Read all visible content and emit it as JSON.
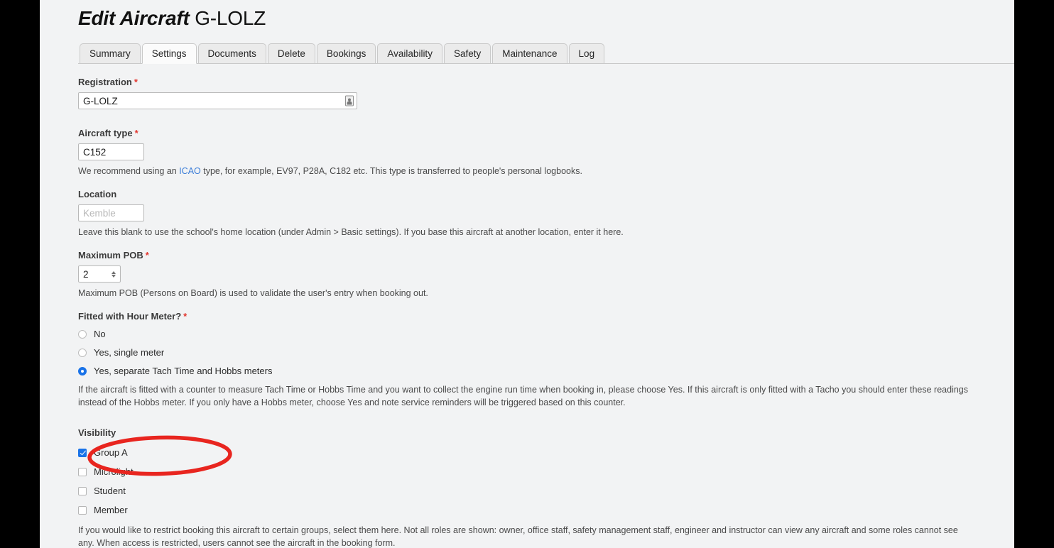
{
  "header": {
    "title_italic": "Edit Aircraft",
    "title_registration": "G-LOLZ"
  },
  "tabs": [
    {
      "label": "Summary",
      "active": false
    },
    {
      "label": "Settings",
      "active": true
    },
    {
      "label": "Documents",
      "active": false
    },
    {
      "label": "Delete",
      "active": false
    },
    {
      "label": "Bookings",
      "active": false
    },
    {
      "label": "Availability",
      "active": false
    },
    {
      "label": "Safety",
      "active": false
    },
    {
      "label": "Maintenance",
      "active": false
    },
    {
      "label": "Log",
      "active": false
    }
  ],
  "form": {
    "registration": {
      "label": "Registration",
      "required_marker": "*",
      "value": "G-LOLZ"
    },
    "aircraft_type": {
      "label": "Aircraft type",
      "required_marker": "*",
      "value": "C152",
      "help_before_link": "We recommend using an ",
      "help_link": "ICAO",
      "help_after_link": " type, for example, EV97, P28A, C182 etc. This type is transferred to people's personal logbooks."
    },
    "location": {
      "label": "Location",
      "value": "",
      "placeholder": "Kemble",
      "help": "Leave this blank to use the school's home location (under Admin > Basic settings). If you base this aircraft at another location, enter it here."
    },
    "maximum_pob": {
      "label": "Maximum POB",
      "required_marker": "*",
      "value": "2",
      "help": "Maximum POB (Persons on Board) is used to validate the user's entry when booking out."
    },
    "hour_meter": {
      "label": "Fitted with Hour Meter?",
      "required_marker": "*",
      "options": [
        {
          "label": "No",
          "selected": false
        },
        {
          "label": "Yes, single meter",
          "selected": false
        },
        {
          "label": "Yes, separate Tach Time and Hobbs meters",
          "selected": true
        }
      ],
      "help_line_1": "If the aircraft is fitted with a counter to measure Tach Time or Hobbs Time and you want to collect the engine run time when booking in, please choose Yes. If this aircraft is only fitted with a Tacho you should enter these readings instead",
      "help_line_2": "of the Hobbs meter. If you only have a Hobbs meter, choose Yes and note service reminders will be triggered based on this counter."
    },
    "visibility": {
      "label": "Visibility",
      "options": [
        {
          "label": "Group A",
          "checked": true
        },
        {
          "label": "Microlight",
          "checked": false
        },
        {
          "label": "Student",
          "checked": false
        },
        {
          "label": "Member",
          "checked": false
        }
      ],
      "help_line_1": "If you would like to restrict booking this aircraft to certain groups, select them here. Not all roles are shown: owner, office staff, safety management staff, engineer and instructor can view any aircraft and some roles cannot see any.",
      "help_line_2": "When access is restricted, users cannot see the aircraft in the booking form."
    }
  },
  "annotation": {
    "shape": "ellipse",
    "color": "#e8251f",
    "target": "Group A and Microlight visibility checkboxes"
  },
  "colors": {
    "accent": "#1a73e8",
    "required": "#e2372f",
    "link": "#3b7dd8",
    "page_background": "#f2f3f4",
    "annotation": "#e8251f"
  }
}
